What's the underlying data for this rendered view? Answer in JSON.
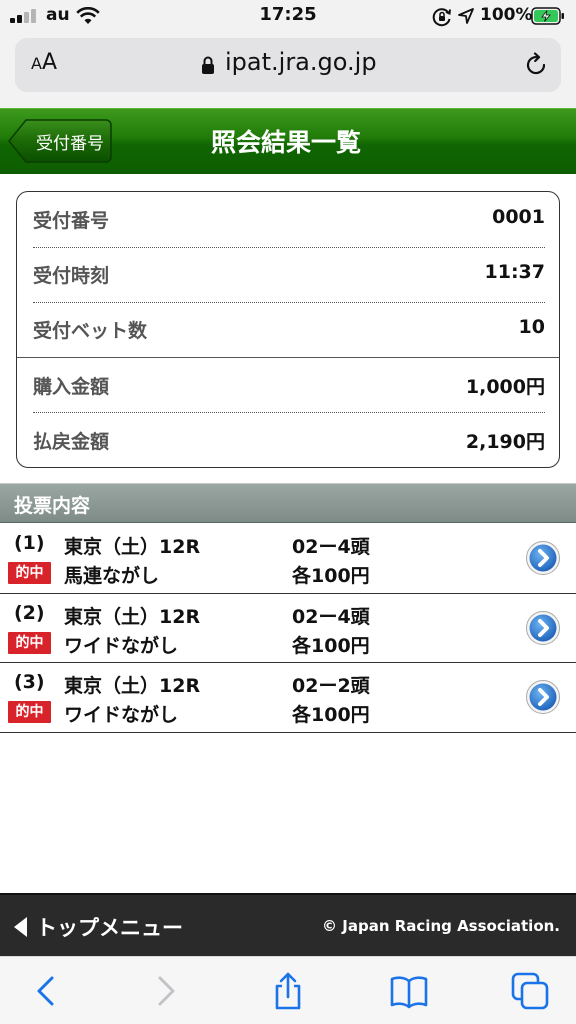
{
  "status_bar": {
    "carrier": "au",
    "time": "17:25",
    "battery_percent": "100%",
    "icons": [
      "signal-icon",
      "wifi-icon",
      "orientation-lock-icon",
      "location-icon",
      "battery-charging-icon"
    ]
  },
  "browser": {
    "text_size_button": "AA",
    "url": "ipat.jra.go.jp",
    "icons": [
      "lock-icon",
      "reload-icon"
    ]
  },
  "header": {
    "back_label": "受付番号",
    "title": "照会結果一覧",
    "accent_color": "#1f7a08"
  },
  "summary": {
    "rows": [
      {
        "label": "受付番号",
        "value": "0001"
      },
      {
        "label": "受付時刻",
        "value": "11:37"
      },
      {
        "label": "受付ベット数",
        "value": "10"
      },
      {
        "label": "購入金額",
        "value": "1,000円"
      },
      {
        "label": "払戻金額",
        "value": "2,190円"
      }
    ]
  },
  "votes": {
    "section_title": "投票内容",
    "items": [
      {
        "number": "(1)",
        "race": "東京（土）12R",
        "combination": "02ー4頭",
        "badge": "的中",
        "bet_type": "馬連ながし",
        "amount": "各100円"
      },
      {
        "number": "(2)",
        "race": "東京（土）12R",
        "combination": "02ー4頭",
        "badge": "的中",
        "bet_type": "ワイドながし",
        "amount": "各100円"
      },
      {
        "number": "(3)",
        "race": "東京（土）12R",
        "combination": "02ー2頭",
        "badge": "的中",
        "bet_type": "ワイドながし",
        "amount": "各100円"
      }
    ],
    "badge_color": "#d8232a"
  },
  "footer": {
    "top_menu": "トップメニュー",
    "copyright": "© Japan Racing Association."
  },
  "toolbar": {
    "icons": [
      "back-icon",
      "forward-icon",
      "share-icon",
      "bookmarks-icon",
      "tabs-icon"
    ],
    "accent_color": "#1a73e8"
  }
}
